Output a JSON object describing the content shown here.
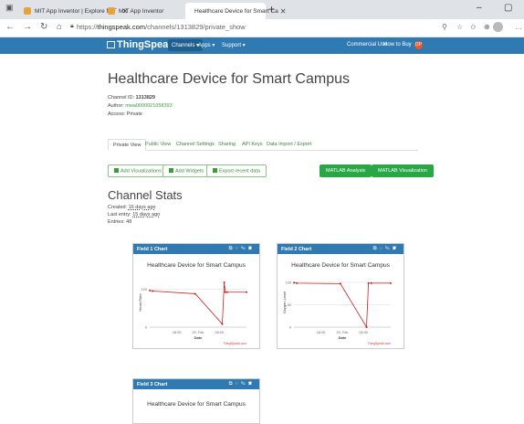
{
  "browser": {
    "tabs": [
      {
        "label": "MIT App Inventor | Explore MIT"
      },
      {
        "label": "MIT App Inventor"
      },
      {
        "label": "Healthcare Device for Smart Ca"
      }
    ],
    "url_prefix": "https://",
    "url_host": "thingspeak.com",
    "url_path": "/channels/1313829/private_show"
  },
  "header": {
    "logo": "ThingSpeak",
    "trademark": "™",
    "nav": [
      "Channels ▾",
      "Apps ▾",
      "Support ▾"
    ],
    "right_links": [
      "Commercial Use",
      "How to Buy"
    ],
    "user_initials": "DP"
  },
  "channel": {
    "title": "Healthcare Device for Smart Campus",
    "id_label": "Channel ID:",
    "id_value": "1313829",
    "author_label": "Author:",
    "author_value": "mwa0000021058393",
    "access": "Access: Private"
  },
  "page_tabs": [
    "Private View",
    "Public View",
    "Channel Settings",
    "Sharing",
    "API Keys",
    "Data Import / Export"
  ],
  "buttons": {
    "add_visualizations": "Add Visualizations",
    "add_widgets": "Add Widgets",
    "export": "Export recent data",
    "matlab_analysis": "MATLAB Analysis",
    "matlab_visualization": "MATLAB Visualization"
  },
  "stats": {
    "title": "Channel Stats",
    "created_label": "Created:",
    "created_value": "16 days ago",
    "last_entry_label": "Last entry:",
    "last_entry_value": "15 days ago",
    "entries": "Entries: 48"
  },
  "charts": [
    {
      "header": "Field 1 Chart",
      "title": "Healthcare Device for Smart Campus",
      "ylabel": "Heart Rate",
      "xlabel": "Date",
      "credit": "ThingSpeak.com",
      "xticks": [
        "18:00",
        "20. Feb",
        "06:00"
      ],
      "yticks": [
        "100",
        "0"
      ]
    },
    {
      "header": "Field 2 Chart",
      "title": "Healthcare Device for Smart Campus",
      "ylabel": "Oxygen Level",
      "xlabel": "Date",
      "credit": "ThingSpeak.com",
      "xticks": [
        "18:00",
        "20. Feb",
        "06:00"
      ],
      "yticks": [
        "100",
        "50",
        "0"
      ]
    },
    {
      "header": "Field 3 Chart",
      "title": "Healthcare Device for Smart Campus"
    }
  ],
  "chart_data": [
    {
      "type": "line",
      "title": "Healthcare Device for Smart Campus",
      "xlabel": "Date",
      "ylabel": "Heart Rate",
      "x": [
        "17:00",
        "18:30",
        "20. Feb 00:00",
        "02:30",
        "02:40",
        "02:45",
        "03:00",
        "06:00"
      ],
      "series": [
        {
          "values": [
            97,
            95,
            88,
            8,
            118,
            92,
            92,
            92
          ]
        }
      ],
      "ylim": [
        0,
        130
      ]
    },
    {
      "type": "line",
      "title": "Healthcare Device for Smart Campus",
      "xlabel": "Date",
      "ylabel": "Oxygen Level",
      "x": [
        "17:00",
        "18:30",
        "20. Feb 00:00",
        "02:30",
        "02:40",
        "03:00",
        "06:00"
      ],
      "series": [
        {
          "values": [
            99,
            98,
            97,
            0,
            98,
            98,
            98
          ]
        }
      ],
      "ylim": [
        0,
        110
      ]
    }
  ]
}
